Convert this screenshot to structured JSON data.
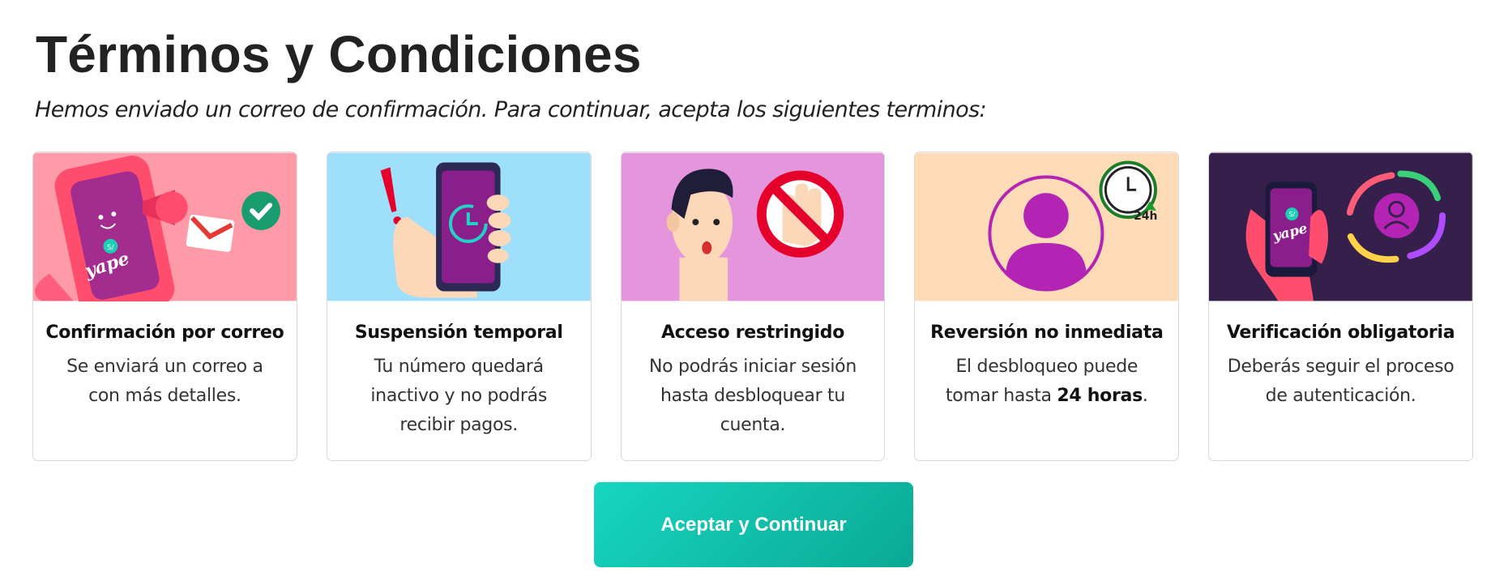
{
  "page": {
    "title": "Términos y Condiciones",
    "subtitle": "Hemos enviado un correo de confirmación. Para continuar, acepta los siguientes terminos:"
  },
  "cards": [
    {
      "title": "Confirmación por correo",
      "line1": "Se enviará un correo a",
      "line2": "con más detalles.",
      "image_bg": "#ff9aa8",
      "icons": [
        "phone-mascot-icon",
        "megaphone-icon",
        "gmail-icon",
        "check-icon"
      ]
    },
    {
      "title": "Suspensión temporal",
      "line1": "Tu número quedará",
      "line2": "inactivo y no podrás",
      "line3": "recibir pagos.",
      "image_bg": "#9edffb",
      "icons": [
        "exclamation-icon",
        "hand-phone-icon",
        "clock-icon"
      ]
    },
    {
      "title": "Acceso restringido",
      "line1": "No podrás iniciar sesión",
      "line2": "hasta desbloquear tu",
      "line3": "cuenta.",
      "image_bg": "#e495dc",
      "icons": [
        "surprised-face-icon",
        "forbidden-hand-icon"
      ]
    },
    {
      "title": "Reversión no inmediata",
      "line1": "El desbloqueo puede",
      "line2_pre": "tomar hasta ",
      "line2_bold": "24 horas",
      "line2_post": ".",
      "image_bg": "#fddbb6",
      "icons": [
        "user-avatar-icon",
        "clock-24h-icon"
      ],
      "badge_text": "24h"
    },
    {
      "title": "Verificación obligatoria",
      "line1": "Deberás seguir el proceso",
      "line2": "de autenticación.",
      "image_bg": "#34204a",
      "icons": [
        "phone-hand-icon",
        "refresh-cycle-icon",
        "user-avatar-icon"
      ]
    }
  ],
  "brand": {
    "logo_text": "yape",
    "coin_text": "S/"
  },
  "button": {
    "label": "Aceptar y Continuar",
    "color_start": "#17d6c0",
    "color_end": "#0aa994"
  }
}
